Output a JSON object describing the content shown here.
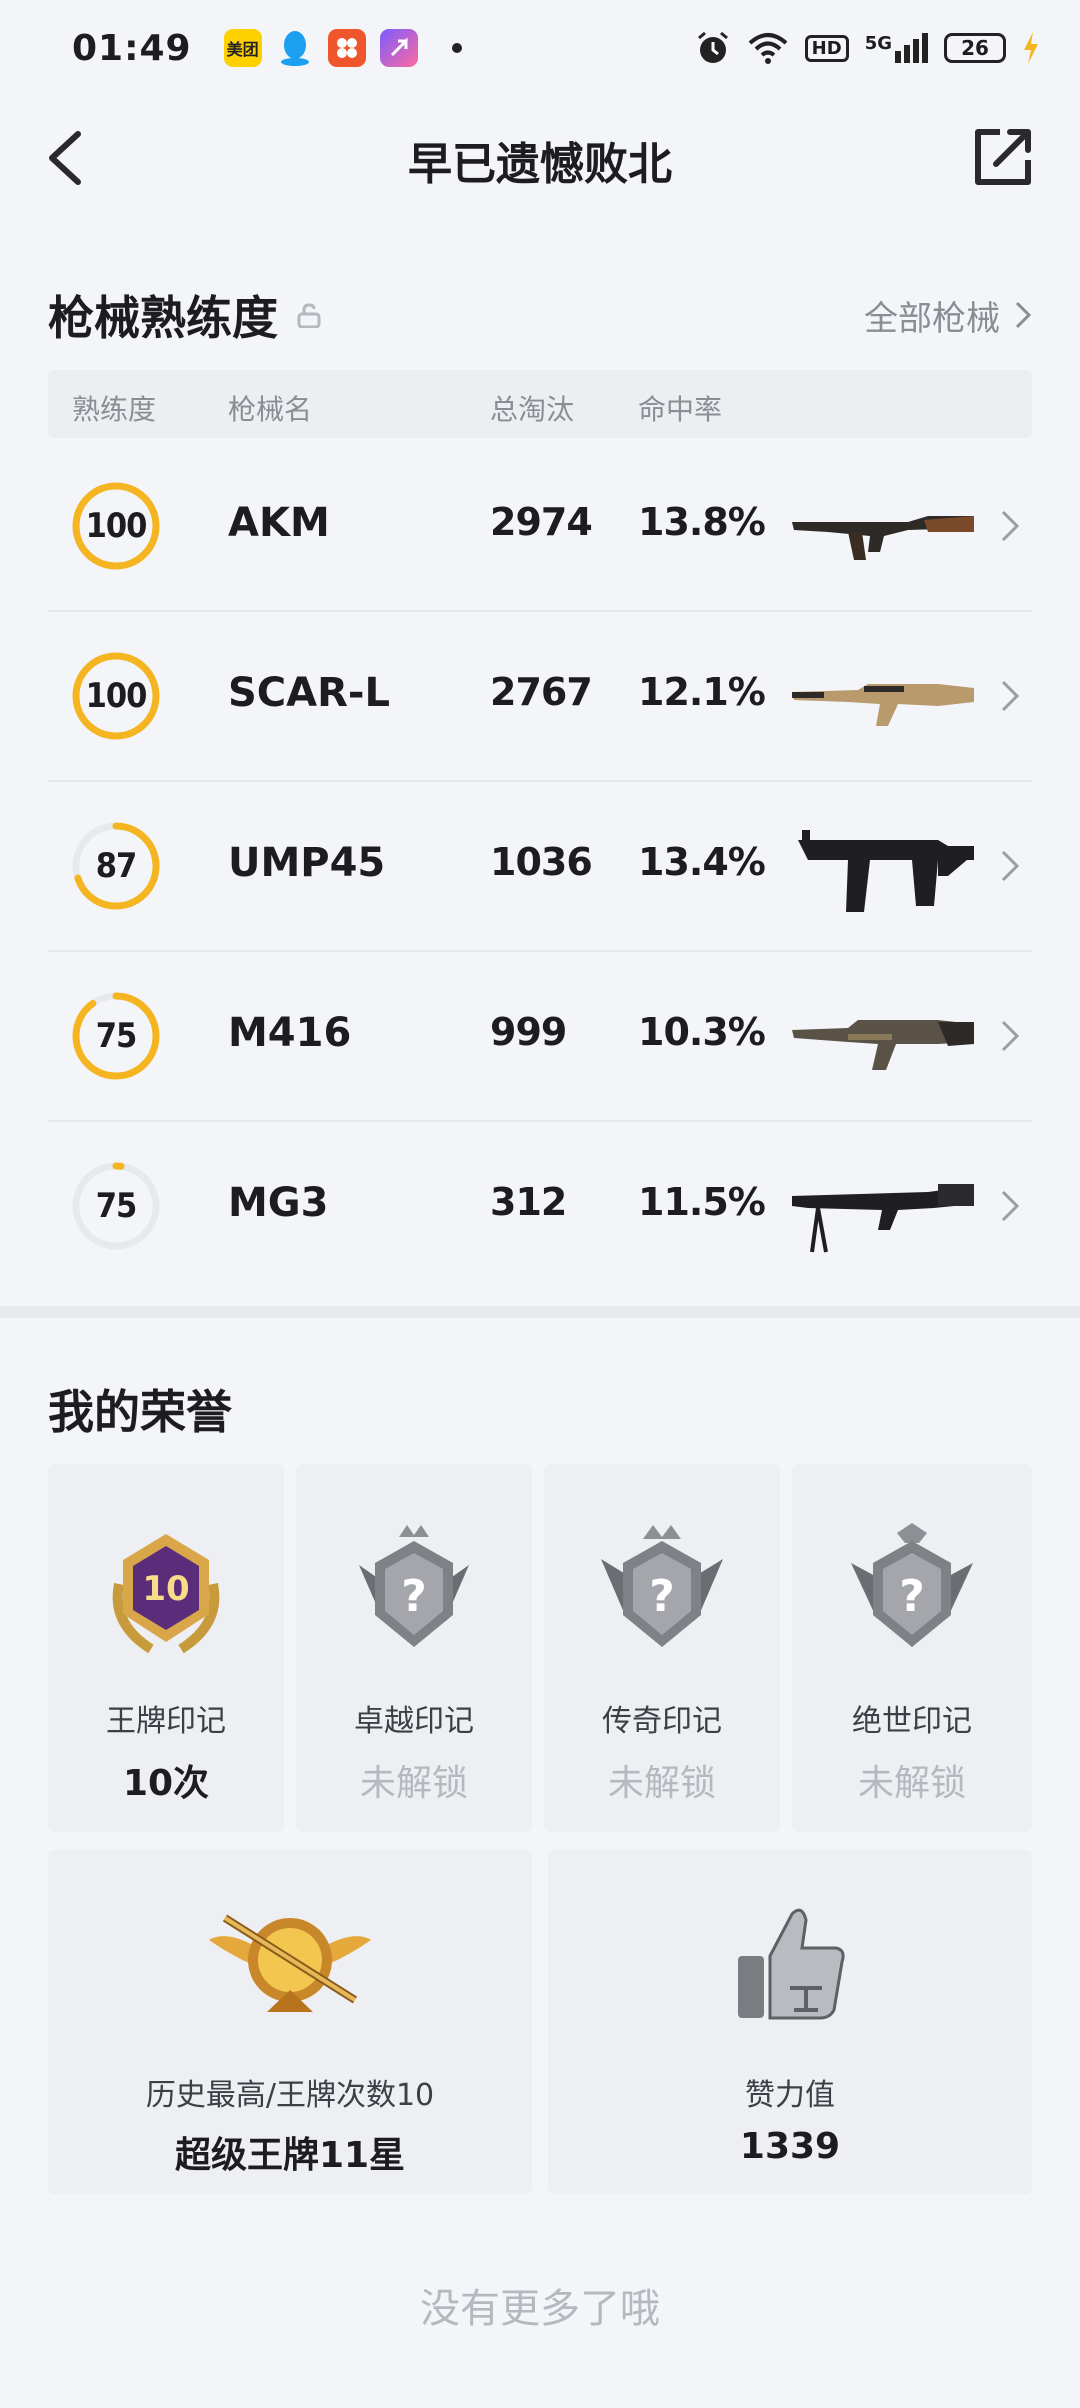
{
  "status_bar": {
    "time": "01:49",
    "apps": [
      "美团",
      "qq-icon",
      "app-icon",
      "shortcut-icon"
    ],
    "network": "5G",
    "hd": "HD",
    "battery": "26"
  },
  "nav": {
    "title": "早已遗憾败北"
  },
  "mastery": {
    "title": "枪械熟练度",
    "all_link": "全部枪械",
    "headers": {
      "level": "熟练度",
      "name": "枪械名",
      "kills": "总淘汰",
      "hit_rate": "命中率"
    },
    "rows": [
      {
        "level": "100",
        "progress": 1.0,
        "name": "AKM",
        "kills": "2974",
        "hit_rate": "13.8%"
      },
      {
        "level": "100",
        "progress": 1.0,
        "name": "SCAR-L",
        "kills": "2767",
        "hit_rate": "12.1%"
      },
      {
        "level": "87",
        "progress": 0.7,
        "name": "UMP45",
        "kills": "1036",
        "hit_rate": "13.4%"
      },
      {
        "level": "75",
        "progress": 0.9,
        "name": "M416",
        "kills": "999",
        "hit_rate": "10.3%"
      },
      {
        "level": "75",
        "progress": 0.02,
        "name": "MG3",
        "kills": "312",
        "hit_rate": "11.5%"
      }
    ]
  },
  "honors": {
    "title": "我的荣誉",
    "badges": [
      {
        "label": "王牌印记",
        "value": "10次",
        "locked": false,
        "badge_number": "10"
      },
      {
        "label": "卓越印记",
        "value": "未解锁",
        "locked": true
      },
      {
        "label": "传奇印记",
        "value": "未解锁",
        "locked": true
      },
      {
        "label": "绝世印记",
        "value": "未解锁",
        "locked": true
      }
    ],
    "highest": {
      "label": "历史最高/王牌次数10",
      "value": "超级王牌11星"
    },
    "likes": {
      "label": "赞力值",
      "value": "1339"
    }
  },
  "footer": "没有更多了哦",
  "colors": {
    "ring_accent": "#f5b521",
    "ring_track": "#e8e9ec",
    "background": "#f3f5f9"
  }
}
